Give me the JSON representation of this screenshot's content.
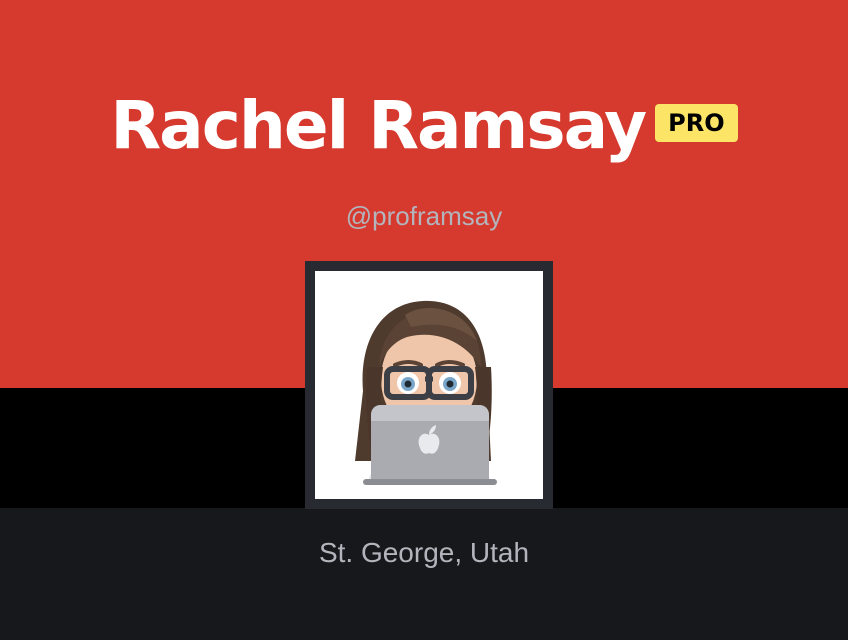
{
  "profile": {
    "name": "Rachel Ramsay",
    "badge": "PRO",
    "username": "@proframsay",
    "location": "St. George, Utah",
    "avatar_icon": "memoji-avatar-with-laptop"
  },
  "colors": {
    "hero_background": "#d63a2f",
    "band": "#000000",
    "panel": "#17181c",
    "badge": "#fce566",
    "muted_text": "#b3b5bd"
  }
}
